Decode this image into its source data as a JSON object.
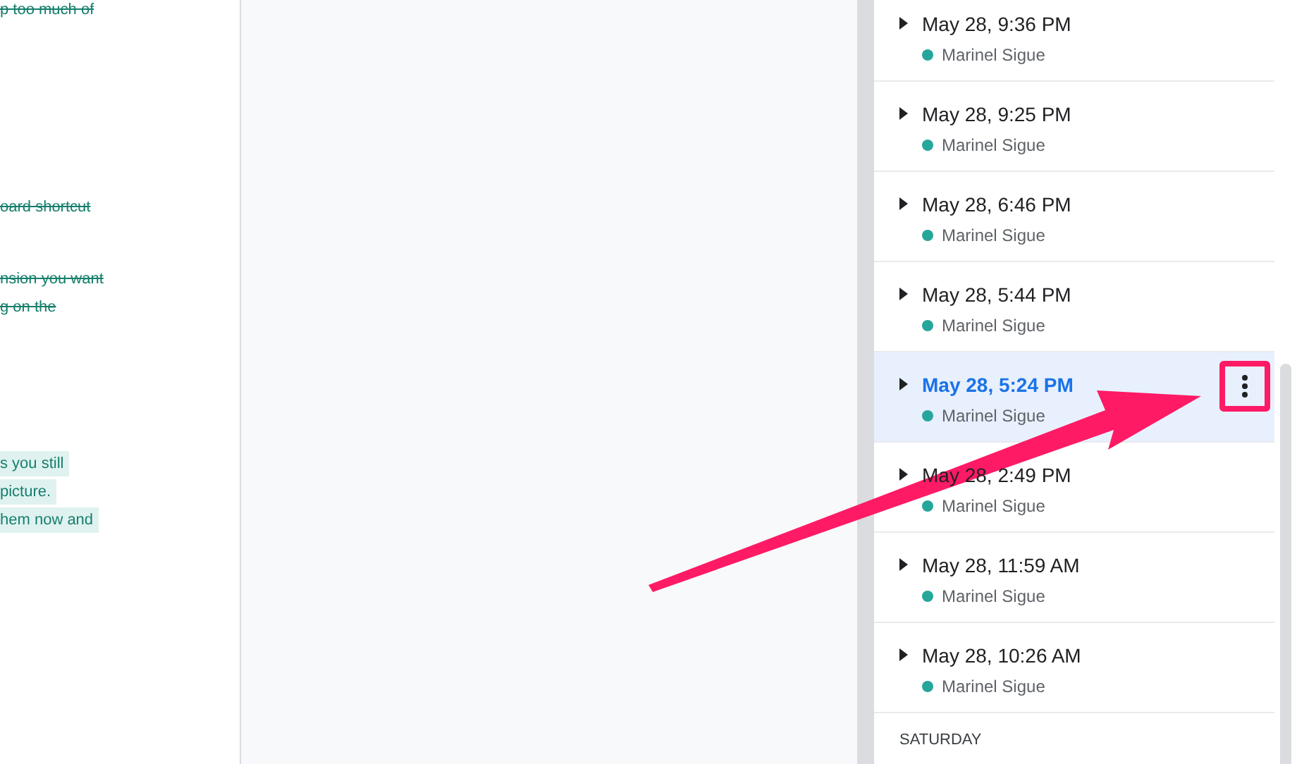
{
  "document_lines": [
    {
      "text": "p too much of",
      "struck": true,
      "highlighted": false
    },
    {
      "text": "oard shortcut",
      "struck": true,
      "highlighted": false
    },
    {
      "text": "nsion you want",
      "struck": true,
      "highlighted": false
    },
    {
      "text": "g on the",
      "struck": true,
      "highlighted": false
    },
    {
      "text": "s you still",
      "struck": false,
      "highlighted": true
    },
    {
      "text": "picture.",
      "struck": false,
      "highlighted": true
    },
    {
      "text": "hem now and",
      "struck": false,
      "highlighted": true
    }
  ],
  "versions": [
    {
      "time": "May 28, 9:36 PM",
      "author": "Marinel Sigue",
      "color": "#26a69a",
      "selected": false
    },
    {
      "time": "May 28, 9:25 PM",
      "author": "Marinel Sigue",
      "color": "#26a69a",
      "selected": false
    },
    {
      "time": "May 28, 6:46 PM",
      "author": "Marinel Sigue",
      "color": "#26a69a",
      "selected": false
    },
    {
      "time": "May 28, 5:44 PM",
      "author": "Marinel Sigue",
      "color": "#26a69a",
      "selected": false
    },
    {
      "time": "May 28, 5:24 PM",
      "author": "Marinel Sigue",
      "color": "#26a69a",
      "selected": true
    },
    {
      "time": "May 28, 2:49 PM",
      "author": "Marinel Sigue",
      "color": "#26a69a",
      "selected": false
    },
    {
      "time": "May 28, 11:59 AM",
      "author": "Marinel Sigue",
      "color": "#26a69a",
      "selected": false
    },
    {
      "time": "May 28, 10:26 AM",
      "author": "Marinel Sigue",
      "color": "#26a69a",
      "selected": false
    }
  ],
  "section_header": "SATURDAY"
}
